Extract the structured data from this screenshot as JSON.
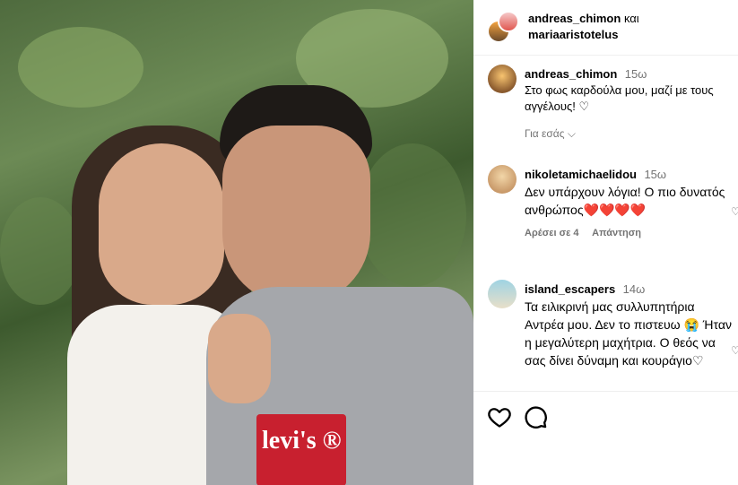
{
  "post": {
    "authors": {
      "first": "andreas_chimon",
      "conj": "και",
      "second": "mariaaristotelus"
    }
  },
  "caption": {
    "user": "andreas_chimon",
    "time": "15ω",
    "text": "Στο φως καρδούλα μου, μαζί με τους αγγέλους! ♡",
    "translate": "Για εσάς ⌵"
  },
  "comments": [
    {
      "user": "nikoletamichaelidou",
      "time": "15ω",
      "text": "Δεν υπάρχουν λόγια! Ο πιο δυνατός ανθρώπος❤️❤️❤️❤️",
      "likes": "Αρέσει σε 4",
      "reply": "Απάντηση"
    },
    {
      "user": "island_escapers",
      "time": "14ω",
      "text": "Τα ειλικρινή μας συλλυπητήρια Αντρέα μου. Δεν το πιστευω 😭 Ήταν η μεγαλύτερη μαχήτρια. Ο θεός να σας δίνει δύναμη και κουράγιο♡"
    }
  ],
  "photo_text": "levi's ®",
  "icons": {
    "like": "heart-outline-icon",
    "comment": "comment-bubble-icon"
  },
  "colors": {
    "muted": "#737373",
    "border": "#efefef",
    "heart": "#e0245e"
  }
}
